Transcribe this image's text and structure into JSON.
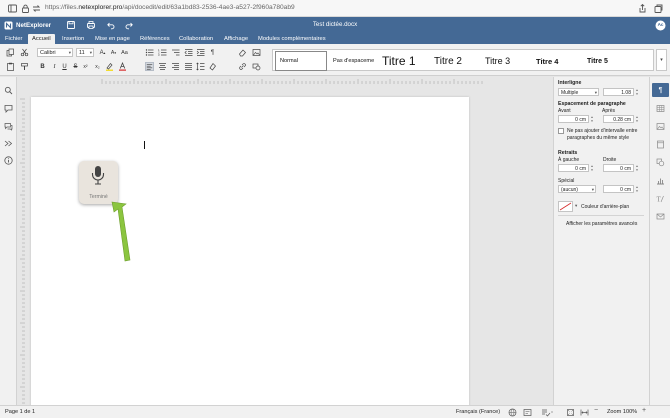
{
  "browser": {
    "url_prefix": "https://files.",
    "url_domain": "netexplorer.pro",
    "url_path": "/api/docedit/edit/63a1bd83-2536-4ae3-a527-2f960a780ab9"
  },
  "app": {
    "brand": "NetExplorer",
    "doc_title": "Test dictée.docx",
    "avatar": "Ac",
    "accent": "#446995"
  },
  "tabs": [
    "Fichier",
    "Accueil",
    "Insertion",
    "Mise en page",
    "Références",
    "Collaboration",
    "Affichage",
    "Modules complémentaires"
  ],
  "toolbar": {
    "font_name": "Calibri",
    "font_size": "11",
    "styles": [
      "Normal",
      "Pas d'espaceme",
      "Titre 1",
      "Titre 2",
      "Titre 3",
      "Titre 4",
      "Titre 5"
    ]
  },
  "dictation": {
    "label": "Terminé"
  },
  "right_panel": {
    "line_spacing_heading": "Interligne",
    "line_spacing_mode": "Multiple",
    "line_spacing_value": "1.08",
    "para_spacing_heading": "Espacement de paragraphe",
    "before_label": "Avant",
    "after_label": "Après",
    "before_value": "0 cm",
    "after_value": "0.28 cm",
    "no_interval_label": "Ne pas ajouter d'intervalle entre paragraphes du même style",
    "indent_heading": "Retraits",
    "left_label": "À gauche",
    "right_label": "Droite",
    "left_value": "0 cm",
    "right_value": "0 cm",
    "special_label": "Spécial",
    "special_value": "(aucun)",
    "special_amount": "0 cm",
    "bg_color_label": "Couleur d'arrière-plan",
    "advanced_link": "Afficher les paramètres avancés"
  },
  "status": {
    "page": "Page 1 de 1",
    "language": "Français (France)",
    "zoom": "Zoom 100%"
  }
}
